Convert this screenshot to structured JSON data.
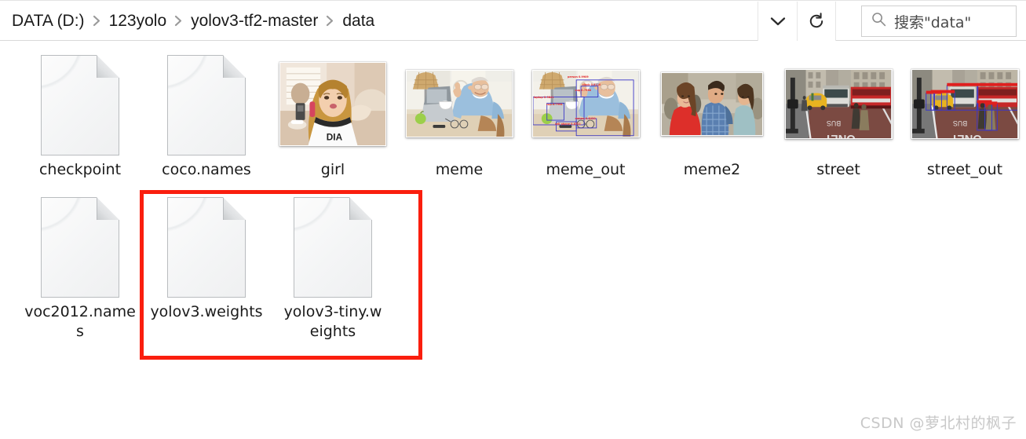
{
  "window": {
    "type": "file-explorer",
    "breadcrumb": {
      "separator_icon": "chevron-right-icon",
      "items": [
        "DATA (D:)",
        "123yolo",
        "yolov3-tf2-master",
        "data"
      ]
    },
    "toolbar": {
      "dropdown_icon": "chevron-down-icon",
      "refresh_icon": "refresh-icon",
      "dropdown_label": "",
      "refresh_label": ""
    },
    "search": {
      "icon": "search-icon",
      "placeholder": "搜索\"data\""
    }
  },
  "files": [
    {
      "name": "checkpoint",
      "kind": "file",
      "icon": "blank-document-icon",
      "row": 1,
      "col": 1
    },
    {
      "name": "coco.names",
      "kind": "file",
      "icon": "blank-document-icon",
      "row": 1,
      "col": 2
    },
    {
      "name": "girl",
      "kind": "image",
      "icon": "photo-thumbnail",
      "row": 1,
      "col": 3
    },
    {
      "name": "meme",
      "kind": "image",
      "icon": "photo-thumbnail",
      "row": 1,
      "col": 4
    },
    {
      "name": "meme_out",
      "kind": "image",
      "icon": "photo-thumbnail",
      "row": 1,
      "col": 5
    },
    {
      "name": "meme2",
      "kind": "image",
      "icon": "photo-thumbnail",
      "row": 1,
      "col": 6
    },
    {
      "name": "street",
      "kind": "image",
      "icon": "photo-thumbnail",
      "row": 1,
      "col": 7
    },
    {
      "name": "street_out",
      "kind": "image",
      "icon": "photo-thumbnail",
      "row": 1,
      "col": 8
    },
    {
      "name": "voc2012.names",
      "kind": "file",
      "icon": "blank-document-icon",
      "row": 2,
      "col": 1
    },
    {
      "name": "yolov3.weights",
      "kind": "file",
      "icon": "blank-document-icon",
      "row": 2,
      "col": 2
    },
    {
      "name": "yolov3-tiny.weights",
      "kind": "file",
      "icon": "blank-document-icon",
      "row": 2,
      "col": 3
    }
  ],
  "annotation": {
    "shape": "rectangle",
    "color": "#fa1e0e",
    "highlights": [
      "yolov3.weights",
      "yolov3-tiny.weights"
    ]
  },
  "detection_labels": {
    "meme_out": [
      "person 0.9909",
      "clock 0.8110",
      "cup 0.7988",
      "laptop 0.9841",
      "cup 0.7994",
      "mouse 0.8430",
      "cell phone 0.8721"
    ]
  },
  "watermark": "CSDN @萝北村的枫子"
}
